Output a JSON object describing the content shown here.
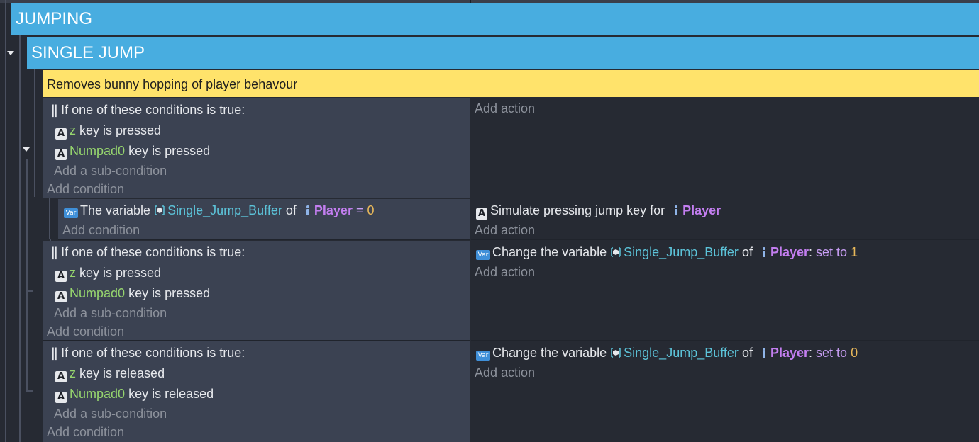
{
  "groups": {
    "outer": "JUMPING",
    "inner": "SINGLE JUMP"
  },
  "comment": "Removes bunny hopping of player behavour",
  "labels": {
    "add_action": "Add action",
    "add_condition": "Add condition",
    "add_sub_condition": "Add a sub-condition",
    "or_header": "If one of these conditions is true:",
    "key_is_pressed": "key is pressed",
    "key_is_released": "key is released"
  },
  "keys": {
    "z": "z",
    "numpad0": "Numpad0"
  },
  "event2": {
    "cond_prefix": "The variable",
    "variable": "Single_Jump_Buffer",
    "of": "of",
    "object": "Player",
    "op": "=",
    "value": "0",
    "action_text": "Simulate pressing jump key for",
    "action_object": "Player"
  },
  "event3": {
    "action_prefix": "Change the variable",
    "variable": "Single_Jump_Buffer",
    "of": "of",
    "object": "Player",
    "colon": ":",
    "set_to": "set to",
    "value": "1"
  },
  "event4": {
    "action_prefix": "Change the variable",
    "variable": "Single_Jump_Buffer",
    "of": "of",
    "object": "Player",
    "colon": ":",
    "set_to": "set to",
    "value": "0"
  },
  "icons": {
    "keyboard": "A",
    "variable": "Var"
  },
  "colors": {
    "group_header": "#48ade0",
    "comment": "#ffe36b",
    "condition_bg": "#3b4252",
    "background": "#262a33",
    "key_name": "#96d56e",
    "variable_name": "#5cc3d9",
    "object_name": "#c37ef0",
    "number": "#e8b85a"
  }
}
